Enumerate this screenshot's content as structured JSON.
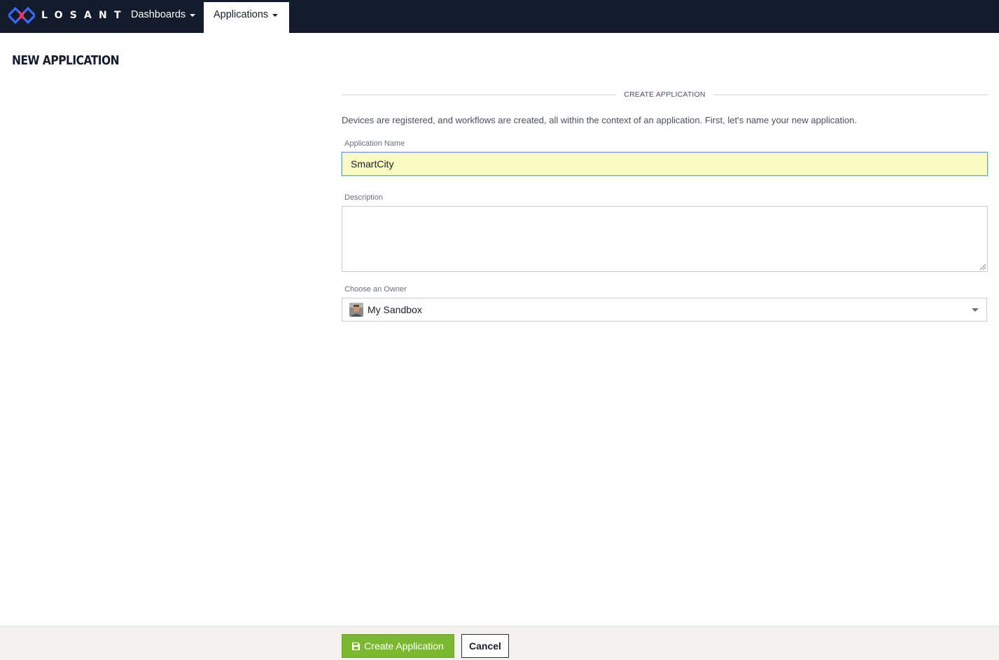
{
  "colors": {
    "navbar": "#131b2c",
    "accent_green": "#7cb82f",
    "input_highlight": "#fafcc3",
    "focus_border": "#6aa3d8"
  },
  "navbar": {
    "brand": "LOSANT",
    "brand_icon": "losant-logo-icon",
    "items": [
      {
        "label": "Dashboards",
        "active": false
      },
      {
        "label": "Applications",
        "active": true
      }
    ]
  },
  "page": {
    "title": "NEW APPLICATION"
  },
  "form": {
    "section_label": "CREATE APPLICATION",
    "intro": "Devices are registered, and workflows are created, all within the context of an application. First, let’s name your new application.",
    "fields": {
      "name": {
        "label": "Application Name",
        "value": "SmartCity"
      },
      "description": {
        "label": "Description",
        "value": ""
      },
      "owner": {
        "label": "Choose an Owner",
        "value": "My Sandbox",
        "icon": "user-avatar-icon"
      }
    }
  },
  "footer": {
    "create_label": "Create Application",
    "create_icon": "save-icon",
    "cancel_label": "Cancel"
  }
}
